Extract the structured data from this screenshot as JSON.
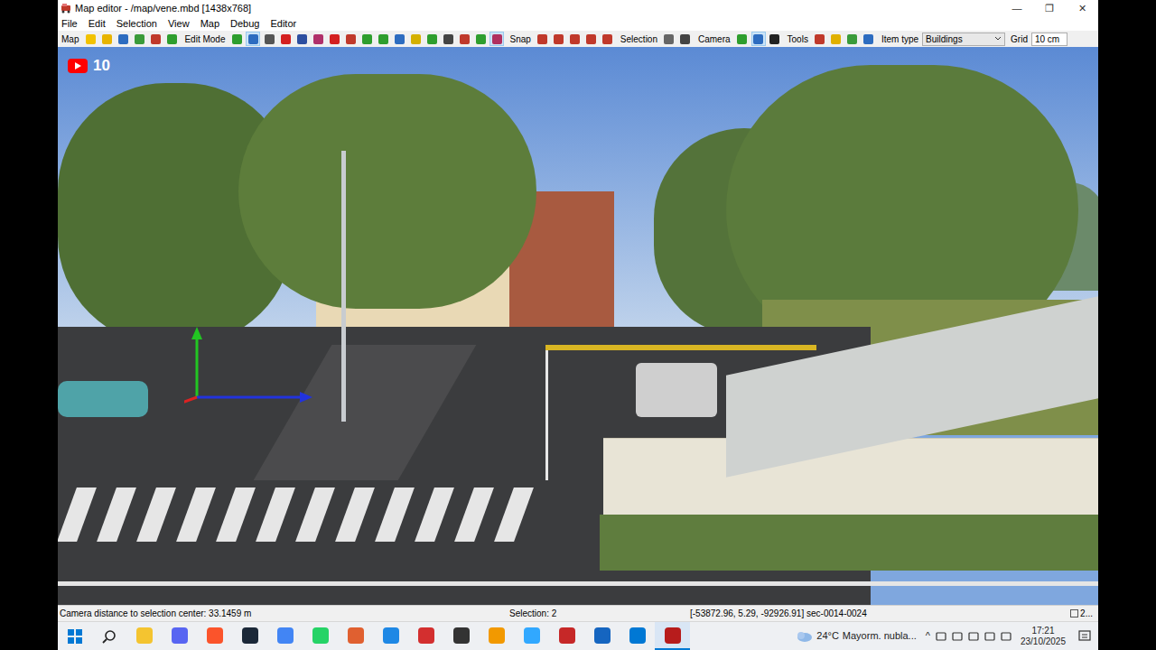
{
  "window": {
    "title": "Map editor - /map/vene.mbd [1438x768]",
    "controls": [
      "—",
      "❐",
      "✕"
    ]
  },
  "menu": [
    "File",
    "Edit",
    "Selection",
    "View",
    "Map",
    "Debug",
    "Editor"
  ],
  "toolbar": {
    "groups": [
      {
        "label": "Map",
        "buttons": [
          {
            "color": "#f2c200",
            "selected": false
          },
          {
            "color": "#e8b400",
            "selected": false
          },
          {
            "color": "#2d6cc0",
            "selected": false
          },
          {
            "color": "#3a9b3a",
            "selected": false
          },
          {
            "color": "#c0392b",
            "selected": false
          },
          {
            "color": "#2e9e2e",
            "selected": false
          }
        ]
      },
      {
        "label": "Edit Mode",
        "buttons": [
          {
            "color": "#2e9e2e",
            "selected": false
          },
          {
            "color": "#2d6cc0",
            "selected": true
          },
          {
            "color": "#555555",
            "selected": false
          },
          {
            "color": "#d42020",
            "selected": false
          },
          {
            "color": "#2d4fa0",
            "selected": false
          },
          {
            "color": "#b0306a",
            "selected": false
          },
          {
            "color": "#d42020",
            "selected": false
          },
          {
            "color": "#c0392b",
            "selected": false
          },
          {
            "color": "#2e9e2e",
            "selected": false
          },
          {
            "color": "#2e9e2e",
            "selected": false
          },
          {
            "color": "#2d6cc0",
            "selected": false
          },
          {
            "color": "#d4b000",
            "selected": false
          },
          {
            "color": "#2e9e2e",
            "selected": false
          },
          {
            "color": "#444444",
            "selected": false
          },
          {
            "color": "#c0392b",
            "selected": false
          },
          {
            "color": "#2e9e2e",
            "selected": false
          },
          {
            "color": "#b03060",
            "selected": true
          }
        ]
      },
      {
        "label": "Snap",
        "buttons": [
          {
            "color": "#c0392b",
            "selected": false
          },
          {
            "color": "#c0392b",
            "selected": false
          },
          {
            "color": "#c0392b",
            "selected": false
          },
          {
            "color": "#c0392b",
            "selected": false
          },
          {
            "color": "#c0392b",
            "selected": false
          }
        ]
      },
      {
        "label": "Selection",
        "buttons": [
          {
            "color": "#666666",
            "selected": false
          },
          {
            "color": "#444444",
            "selected": false
          }
        ]
      },
      {
        "label": "Camera",
        "buttons": [
          {
            "color": "#2e9e2e",
            "selected": false
          },
          {
            "color": "#2d6cc0",
            "selected": true
          },
          {
            "color": "#222222",
            "selected": false
          }
        ]
      },
      {
        "label": "Tools",
        "buttons": [
          {
            "color": "#c0392b",
            "selected": false
          },
          {
            "color": "#e0b000",
            "selected": false
          },
          {
            "color": "#3a9b3a",
            "selected": false
          },
          {
            "color": "#2d6cc0",
            "selected": false
          }
        ]
      }
    ],
    "item_type": {
      "label": "Item type",
      "value": "Buildings"
    },
    "grid": {
      "label": "Grid",
      "value": "10 cm"
    }
  },
  "overlay": {
    "badge": "10"
  },
  "status_bar": {
    "camera": "Camera distance to selection center: 33.1459 m",
    "selection": "Selection: 2",
    "coords": "[-53872.96, 5.29, -92926.91] sec-0014-0024",
    "extra": "2..."
  },
  "taskbar": {
    "apps": [
      {
        "color": "#f4c430",
        "selected": false
      },
      {
        "color": "#5865f2",
        "selected": false
      },
      {
        "color": "#fb542b",
        "selected": false
      },
      {
        "color": "#1b2838",
        "selected": false
      },
      {
        "color": "#4285f4",
        "selected": false
      },
      {
        "color": "#25d366",
        "selected": false
      },
      {
        "color": "#e06030",
        "selected": false
      },
      {
        "color": "#1e88e5",
        "selected": false
      },
      {
        "color": "#d32f2f",
        "selected": false
      },
      {
        "color": "#333333",
        "selected": false
      },
      {
        "color": "#f29900",
        "selected": false
      },
      {
        "color": "#31a8ff",
        "selected": false
      },
      {
        "color": "#c62828",
        "selected": false
      },
      {
        "color": "#1565c0",
        "selected": false
      },
      {
        "color": "#0078d4",
        "selected": false
      },
      {
        "color": "#b71c1c",
        "selected": true
      }
    ],
    "weather": {
      "temp": "24°C",
      "text": "Mayorm. nubla..."
    },
    "tray": "^",
    "time": "17:21",
    "date": "23/10/2025"
  }
}
